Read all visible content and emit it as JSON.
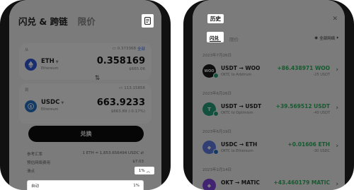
{
  "swap": {
    "tabs": [
      "闪兑 & 跨链",
      "限价"
    ],
    "from": {
      "label": "从",
      "balance": "0.373368",
      "max": "全部",
      "symbol": "ETH",
      "chain": "Ethereum",
      "amount": "0.358169",
      "fiat": "$665.06"
    },
    "to": {
      "label": "到",
      "balance": "113.15856",
      "symbol": "USDC",
      "chain": "Ethereum",
      "amount": "663.9233",
      "fiat": "$663.89 (-0.17%)"
    },
    "swap_button": "兑换",
    "rate_label": "参考汇率",
    "rate_value": "1 ETH = 1,853.656494 USDC",
    "fee_label": "预估网络费用",
    "fee_value": "$7.03",
    "slippage_label": "滑点",
    "slippage_value": "1%",
    "auto_label": "自动",
    "auto_value": "1%"
  },
  "history": {
    "title": "历史",
    "tab_active": "闪兑",
    "tab_inactive": "限价",
    "filter": "全部网络",
    "groups": [
      {
        "date": "2023年7月26日",
        "pair": "USDT → WOO",
        "route": "OKTC to Arbitrum",
        "amount": "+86.438971 WOO",
        "spent": "-25 USDT",
        "icon": "WOO",
        "icon_color": "#1d1d1d"
      },
      {
        "date": "2023年6月26日",
        "pair": "USDT → USDT",
        "route": "OKTC to Optimism",
        "amount": "+39.569512 USDT",
        "spent": "-40 USDT",
        "icon": "T",
        "icon_color": "#26a17b"
      },
      {
        "date": "2023年6月19日",
        "pair": "USDC → ETH",
        "route": "OKTC to Ethereum",
        "amount": "+0.01606 ETH",
        "spent": "-30 USDC",
        "icon": "◆",
        "icon_color": "#627eea"
      },
      {
        "date": "2023年2月14日",
        "pair": "OKT → MATIC",
        "route": "",
        "amount": "+43.460179 MATIC",
        "spent": "",
        "icon": "◆",
        "icon_color": "#8247e5"
      }
    ]
  }
}
